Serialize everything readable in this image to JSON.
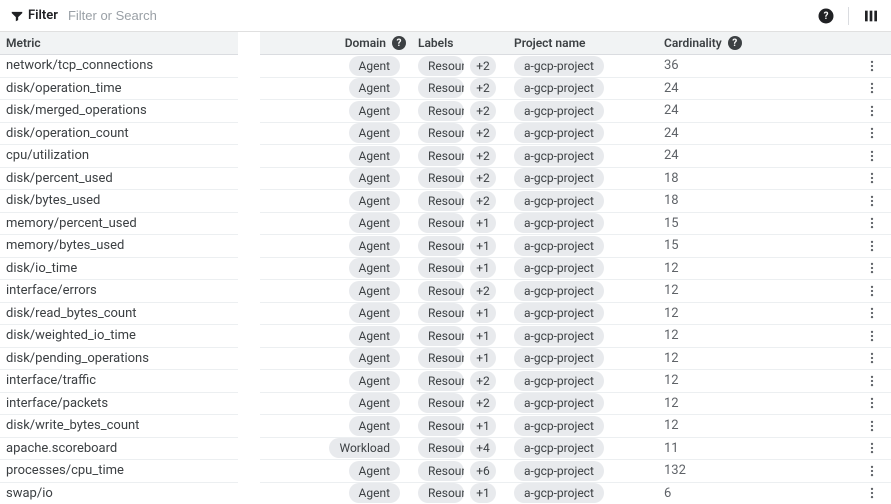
{
  "toolbar": {
    "filter_label": "Filter",
    "search_placeholder": "Filter or Search"
  },
  "columns": {
    "metric": "Metric",
    "domain": "Domain",
    "labels": "Labels",
    "project": "Project name",
    "cardinality": "Cardinality"
  },
  "rows": [
    {
      "metric": "network/tcp_connections",
      "domain": "Agent",
      "label_chip": "Resource: gc…",
      "extra": "+2",
      "project": "a-gcp-project",
      "cardinality": "36"
    },
    {
      "metric": "disk/operation_time",
      "domain": "Agent",
      "label_chip": "Resource: gc…",
      "extra": "+2",
      "project": "a-gcp-project",
      "cardinality": "24"
    },
    {
      "metric": "disk/merged_operations",
      "domain": "Agent",
      "label_chip": "Resource: gc…",
      "extra": "+2",
      "project": "a-gcp-project",
      "cardinality": "24"
    },
    {
      "metric": "disk/operation_count",
      "domain": "Agent",
      "label_chip": "Resource: gc…",
      "extra": "+2",
      "project": "a-gcp-project",
      "cardinality": "24"
    },
    {
      "metric": "cpu/utilization",
      "domain": "Agent",
      "label_chip": "Resource: gc…",
      "extra": "+2",
      "project": "a-gcp-project",
      "cardinality": "24"
    },
    {
      "metric": "disk/percent_used",
      "domain": "Agent",
      "label_chip": "Resource: gc…",
      "extra": "+2",
      "project": "a-gcp-project",
      "cardinality": "18"
    },
    {
      "metric": "disk/bytes_used",
      "domain": "Agent",
      "label_chip": "Resource: gc…",
      "extra": "+2",
      "project": "a-gcp-project",
      "cardinality": "18"
    },
    {
      "metric": "memory/percent_used",
      "domain": "Agent",
      "label_chip": "Resource: gc…",
      "extra": "+1",
      "project": "a-gcp-project",
      "cardinality": "15"
    },
    {
      "metric": "memory/bytes_used",
      "domain": "Agent",
      "label_chip": "Resource: gc…",
      "extra": "+1",
      "project": "a-gcp-project",
      "cardinality": "15"
    },
    {
      "metric": "disk/io_time",
      "domain": "Agent",
      "label_chip": "Resource: gc…",
      "extra": "+1",
      "project": "a-gcp-project",
      "cardinality": "12"
    },
    {
      "metric": "interface/errors",
      "domain": "Agent",
      "label_chip": "Resource: gc…",
      "extra": "+2",
      "project": "a-gcp-project",
      "cardinality": "12"
    },
    {
      "metric": "disk/read_bytes_count",
      "domain": "Agent",
      "label_chip": "Resource: gc…",
      "extra": "+1",
      "project": "a-gcp-project",
      "cardinality": "12"
    },
    {
      "metric": "disk/weighted_io_time",
      "domain": "Agent",
      "label_chip": "Resource: gc…",
      "extra": "+1",
      "project": "a-gcp-project",
      "cardinality": "12"
    },
    {
      "metric": "disk/pending_operations",
      "domain": "Agent",
      "label_chip": "Resource: gc…",
      "extra": "+1",
      "project": "a-gcp-project",
      "cardinality": "12"
    },
    {
      "metric": "interface/traffic",
      "domain": "Agent",
      "label_chip": "Resource: gc…",
      "extra": "+2",
      "project": "a-gcp-project",
      "cardinality": "12"
    },
    {
      "metric": "interface/packets",
      "domain": "Agent",
      "label_chip": "Resource: gc…",
      "extra": "+2",
      "project": "a-gcp-project",
      "cardinality": "12"
    },
    {
      "metric": "disk/write_bytes_count",
      "domain": "Agent",
      "label_chip": "Resource: gc…",
      "extra": "+1",
      "project": "a-gcp-project",
      "cardinality": "12"
    },
    {
      "metric": "apache.scoreboard",
      "domain": "Workload",
      "label_chip": "Resource: gc…",
      "extra": "+4",
      "project": "a-gcp-project",
      "cardinality": "11"
    },
    {
      "metric": "processes/cpu_time",
      "domain": "Agent",
      "label_chip": "Resource: gc…",
      "extra": "+6",
      "project": "a-gcp-project",
      "cardinality": "132"
    },
    {
      "metric": "swap/io",
      "domain": "Agent",
      "label_chip": "Resource: gc…",
      "extra": "+1",
      "project": "a-gcp-project",
      "cardinality": "6"
    }
  ]
}
